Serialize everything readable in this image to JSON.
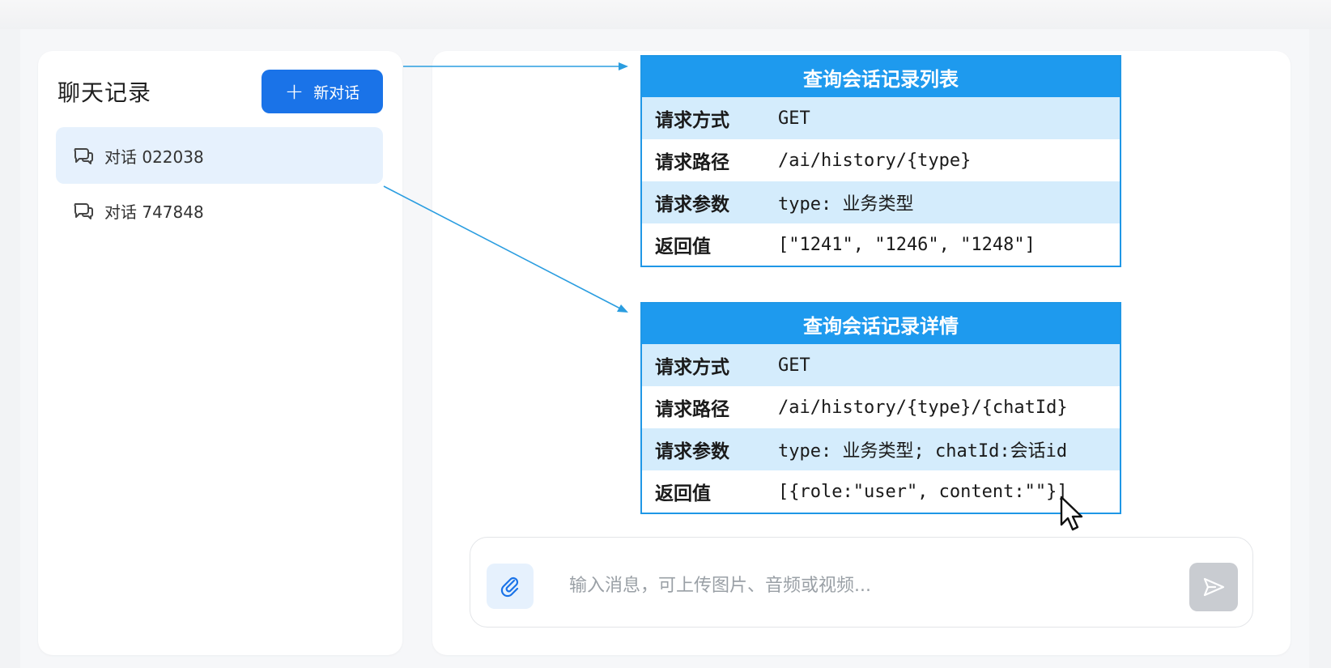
{
  "sidebar": {
    "title": "聊天记录",
    "new_chat_label": "新对话",
    "chats": [
      {
        "label": "对话 022038",
        "active": true
      },
      {
        "label": "对话 747848",
        "active": false
      }
    ]
  },
  "cards": [
    {
      "title": "查询会话记录列表",
      "rows": [
        {
          "key": "请求方式",
          "value": "GET"
        },
        {
          "key": "请求路径",
          "value": "/ai/history/{type}"
        },
        {
          "key": "请求参数",
          "value": "type: 业务类型"
        },
        {
          "key": "返回值",
          "value": "[\"1241\", \"1246\", \"1248\"]"
        }
      ]
    },
    {
      "title": "查询会话记录详情",
      "rows": [
        {
          "key": "请求方式",
          "value": "GET"
        },
        {
          "key": "请求路径",
          "value": "/ai/history/{type}/{chatId}"
        },
        {
          "key": "请求参数",
          "value": "type: 业务类型; chatId:会话id"
        },
        {
          "key": "返回值",
          "value": "[{role:\"user\", content:\"\"}]"
        }
      ]
    }
  ],
  "composer": {
    "placeholder": "输入消息，可上传图片、音频或视频...",
    "value": ""
  },
  "icons": {
    "chat_item": "chat-bubbles-icon",
    "attach": "paperclip-icon",
    "send": "send-icon",
    "new_chat": "plus-icon"
  },
  "colors": {
    "accent": "#1a73e8",
    "card_header": "#1e9aee",
    "card_border": "#1f97e6",
    "row_shade": "#d4ecfc",
    "active_chat_bg": "#e6f1fd",
    "send_disabled": "#c9ccd1"
  }
}
